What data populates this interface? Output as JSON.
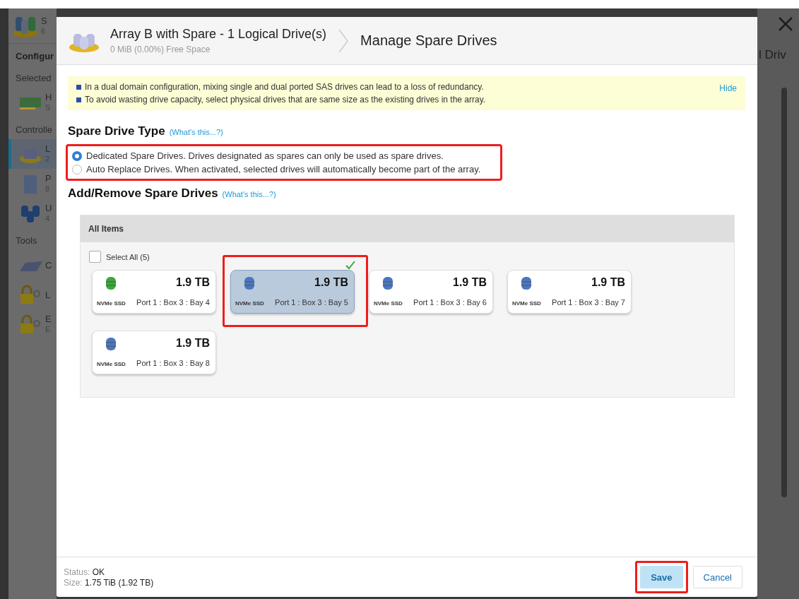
{
  "background": {
    "top": {
      "title": "S",
      "subtitle": "6"
    },
    "sections": [
      {
        "heading": "Configur"
      },
      {
        "heading": "Selected",
        "items": [
          {
            "kind": "card",
            "title": "H",
            "subtitle": "S",
            "selected": false
          }
        ]
      },
      {
        "heading": "Controlle",
        "items": [
          {
            "kind": "array",
            "title": "L",
            "subtitle": "2",
            "selected": true
          },
          {
            "kind": "server",
            "title": "P",
            "subtitle": "8",
            "selected": false
          },
          {
            "kind": "drives",
            "title": "U",
            "subtitle": "4",
            "selected": false
          }
        ]
      },
      {
        "heading": "Tools",
        "items": [
          {
            "kind": "enclosure",
            "title": "C",
            "selected": false
          },
          {
            "kind": "lock",
            "title": "L",
            "selected": false
          },
          {
            "kind": "lock",
            "title": "E",
            "subtitle": "E",
            "selected": false
          }
        ]
      }
    ],
    "right_heading": "l Driv"
  },
  "modal": {
    "title": "Array B with Spare - 1 Logical Drive(s)",
    "subtitle": "0 MiB (0.00%) Free Space",
    "step": "Manage Spare Drives",
    "notice": {
      "lines": [
        "In a dual domain configuration, mixing single and dual ported SAS drives can lead to a loss of redundancy.",
        "To avoid wasting drive capacity, select physical drives that are same size as the existing drives in the array."
      ],
      "hide": "Hide"
    },
    "spare_type": {
      "heading": "Spare Drive Type",
      "help": "(What's this...?)",
      "highlighted": true,
      "options": [
        {
          "label": "Dedicated Spare Drives. Drives designated as spares can only be used as spare drives.",
          "selected": true
        },
        {
          "label": "Auto Replace Drives. When activated, selected drives will automatically become part of the array.",
          "selected": false
        }
      ]
    },
    "spare_drives": {
      "heading": "Add/Remove Spare Drives",
      "help": "(What's this...?)",
      "panel_title": "All Items",
      "select_all": {
        "label": "Select All (5)",
        "checked": false
      },
      "drives": [
        {
          "size": "1.9 TB",
          "type": "NVMe SSD",
          "location": "Port 1 : Box 3 : Bay 4",
          "color": "#3aa83a",
          "selected": false,
          "highlighted": false
        },
        {
          "size": "1.9 TB",
          "type": "NVMe SSD",
          "location": "Port 1 : Box 3 : Bay 5",
          "color": "#4a78c0",
          "selected": true,
          "highlighted": true
        },
        {
          "size": "1.9 TB",
          "type": "NVMe SSD",
          "location": "Port 1 : Box 3 : Bay 6",
          "color": "#4a78c0",
          "selected": false,
          "highlighted": false
        },
        {
          "size": "1.9 TB",
          "type": "NVMe SSD",
          "location": "Port 1 : Box 3 : Bay 7",
          "color": "#4a78c0",
          "selected": false,
          "highlighted": false
        },
        {
          "size": "1.9 TB",
          "type": "NVMe SSD",
          "location": "Port 1 : Box 3 : Bay 8",
          "color": "#4a78c0",
          "selected": false,
          "highlighted": false
        }
      ]
    },
    "footer": {
      "status": [
        {
          "label": "Status:",
          "value": "OK"
        },
        {
          "label": "Size:",
          "value": "1.75 TiB (1.92 TB)"
        }
      ],
      "buttons": [
        {
          "label": "Save",
          "kind": "primary",
          "highlighted": true
        },
        {
          "label": "Cancel",
          "kind": "secondary",
          "highlighted": false
        }
      ]
    }
  }
}
